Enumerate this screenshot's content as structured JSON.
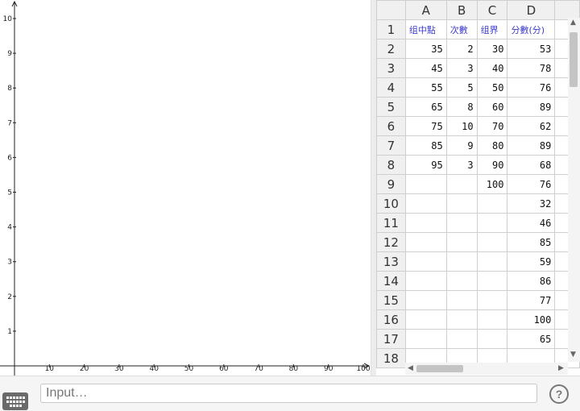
{
  "graphics": {
    "x_ticks": [
      "10",
      "20",
      "30",
      "40",
      "50",
      "60",
      "70",
      "80",
      "90",
      "100"
    ],
    "y_ticks": [
      "1",
      "2",
      "3",
      "4",
      "5",
      "6",
      "7",
      "8",
      "9",
      "10"
    ],
    "x_range": [
      0,
      100
    ],
    "y_range": [
      0,
      10
    ]
  },
  "spreadsheet": {
    "columns": [
      "A",
      "B",
      "C",
      "D"
    ],
    "row_numbers": [
      "1",
      "2",
      "3",
      "4",
      "5",
      "6",
      "7",
      "8",
      "9",
      "10",
      "11",
      "12",
      "13",
      "14",
      "15",
      "16",
      "17",
      "18"
    ],
    "header_row": [
      "组中點",
      "次數",
      "组界",
      "分數(分)"
    ],
    "rows": [
      [
        "35",
        "2",
        "30",
        "53"
      ],
      [
        "45",
        "3",
        "40",
        "78"
      ],
      [
        "55",
        "5",
        "50",
        "76"
      ],
      [
        "65",
        "8",
        "60",
        "89"
      ],
      [
        "75",
        "10",
        "70",
        "62"
      ],
      [
        "85",
        "9",
        "80",
        "89"
      ],
      [
        "95",
        "3",
        "90",
        "68"
      ],
      [
        "",
        "",
        "100",
        "76"
      ],
      [
        "",
        "",
        "",
        "32"
      ],
      [
        "",
        "",
        "",
        "46"
      ],
      [
        "",
        "",
        "",
        "85"
      ],
      [
        "",
        "",
        "",
        "59"
      ],
      [
        "",
        "",
        "",
        "86"
      ],
      [
        "",
        "",
        "",
        "77"
      ],
      [
        "",
        "",
        "",
        "100"
      ],
      [
        "",
        "",
        "",
        "65"
      ],
      [
        "",
        "",
        "",
        ""
      ]
    ]
  },
  "input_bar": {
    "placeholder": "Input…",
    "help_label": "?",
    "keyboard_icon": "keyboard-icon"
  }
}
